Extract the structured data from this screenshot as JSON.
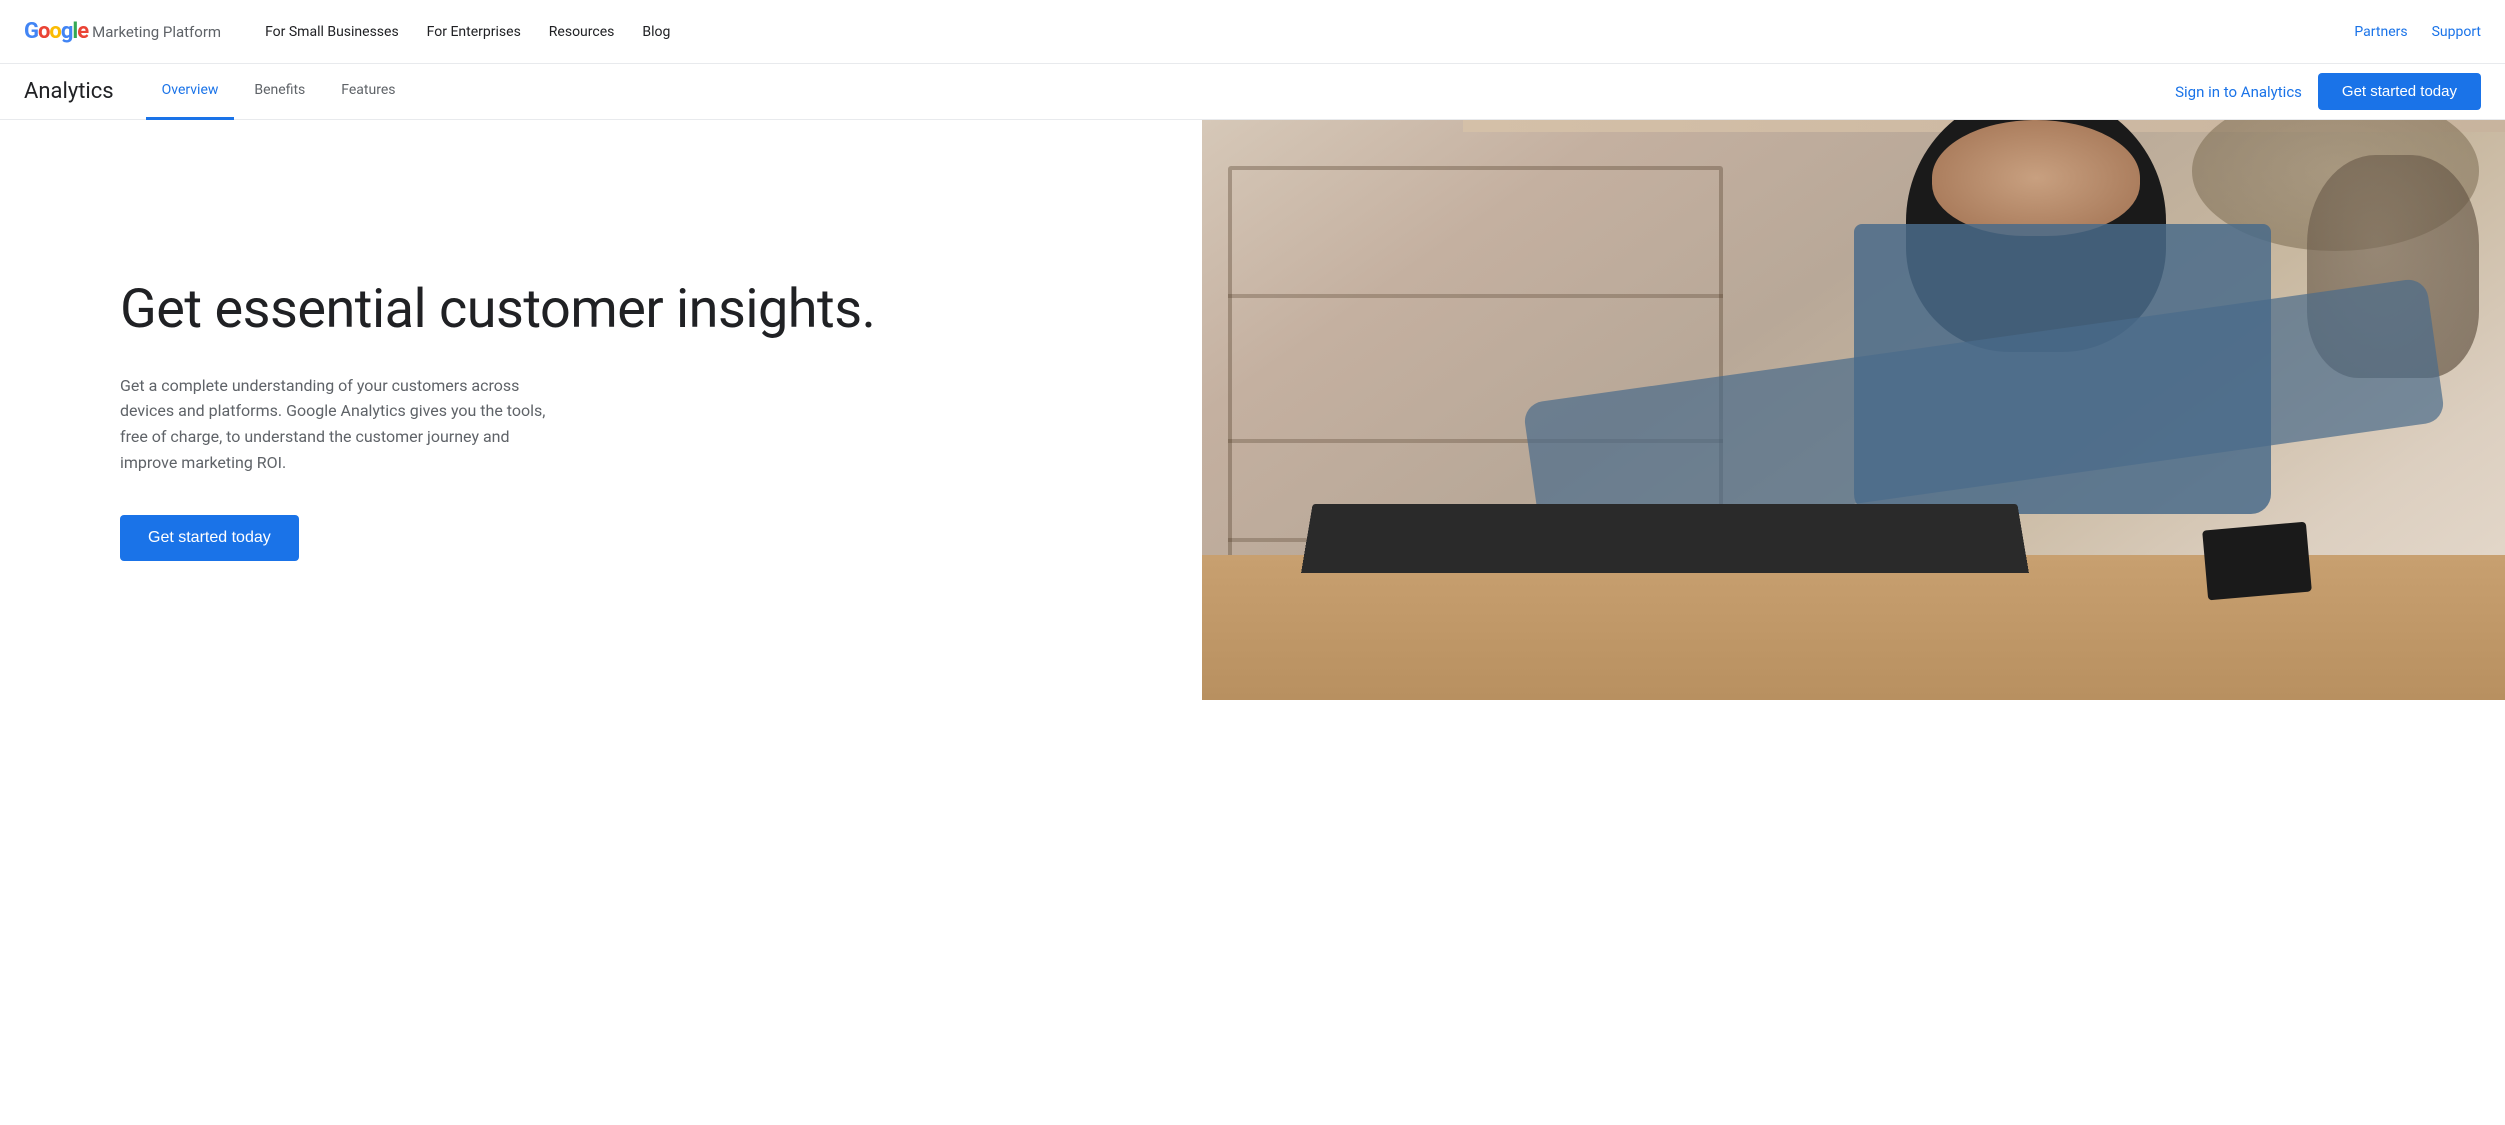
{
  "brand": {
    "google": "Google",
    "platform": "Marketing Platform",
    "google_letters": [
      "G",
      "o",
      "o",
      "g",
      "l",
      "e"
    ],
    "google_colors": [
      "#4285F4",
      "#EA4335",
      "#FBBC04",
      "#4285F4",
      "#34A853",
      "#EA4335"
    ]
  },
  "top_nav": {
    "links": [
      {
        "label": "For Small Businesses",
        "active": false
      },
      {
        "label": "For Enterprises",
        "active": false
      },
      {
        "label": "Resources",
        "active": false
      },
      {
        "label": "Blog",
        "active": false
      }
    ],
    "right_links": [
      {
        "label": "Partners"
      },
      {
        "label": "Support"
      }
    ]
  },
  "sub_nav": {
    "title": "Analytics",
    "links": [
      {
        "label": "Overview",
        "active": true
      },
      {
        "label": "Benefits",
        "active": false
      },
      {
        "label": "Features",
        "active": false
      }
    ],
    "sign_in_label": "Sign in to Analytics",
    "get_started_label": "Get started today"
  },
  "hero": {
    "title": "Get essential customer insights.",
    "description": "Get a complete understanding of your customers across devices and platforms. Google Analytics gives you the tools, free of charge, to understand the customer journey and improve marketing ROI.",
    "cta_label": "Get started today"
  }
}
